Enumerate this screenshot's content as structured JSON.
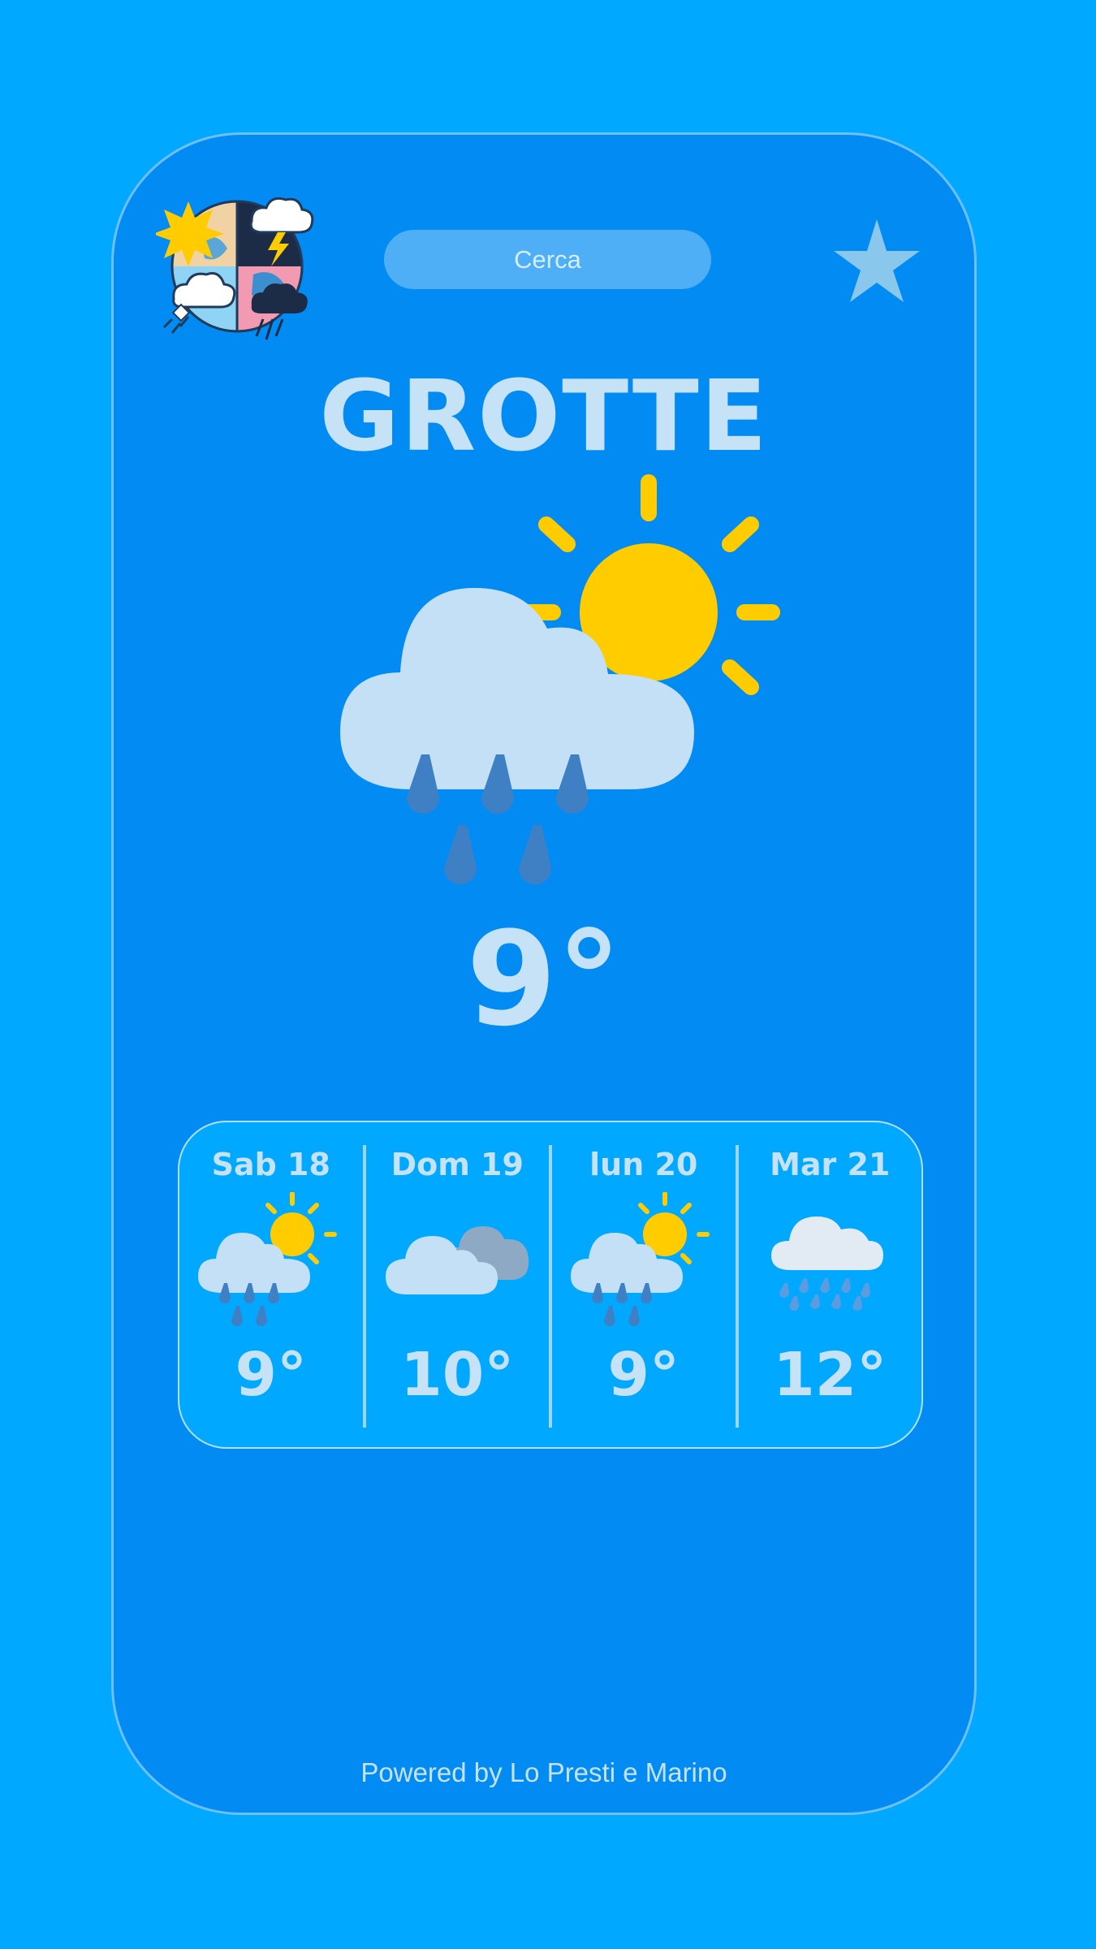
{
  "header": {
    "search_placeholder": "Cerca",
    "logo_icon": "weather-globe-logo-icon",
    "favorite_icon": "star-icon"
  },
  "current": {
    "city": "GROTTE",
    "temperature": "9°",
    "condition_icon": "sun-cloud-rain-icon"
  },
  "forecast": [
    {
      "day": "Sab 18",
      "temperature": "9°",
      "icon": "sun-cloud-rain-icon"
    },
    {
      "day": "Dom 19",
      "temperature": "10°",
      "icon": "cloudy-icon"
    },
    {
      "day": "lun 20",
      "temperature": "9°",
      "icon": "sun-cloud-rain-icon"
    },
    {
      "day": "Mar 21",
      "temperature": "12°",
      "icon": "cloud-rain-icon"
    }
  ],
  "footer": {
    "text": "Powered by Lo Presti e Marino"
  },
  "colors": {
    "background": "#00a8ff",
    "card": "#028cf3",
    "text": "#c6e2f7",
    "sun": "#ffcc00",
    "cloud": "#c4e0f7",
    "rain": "#3f80c4"
  }
}
